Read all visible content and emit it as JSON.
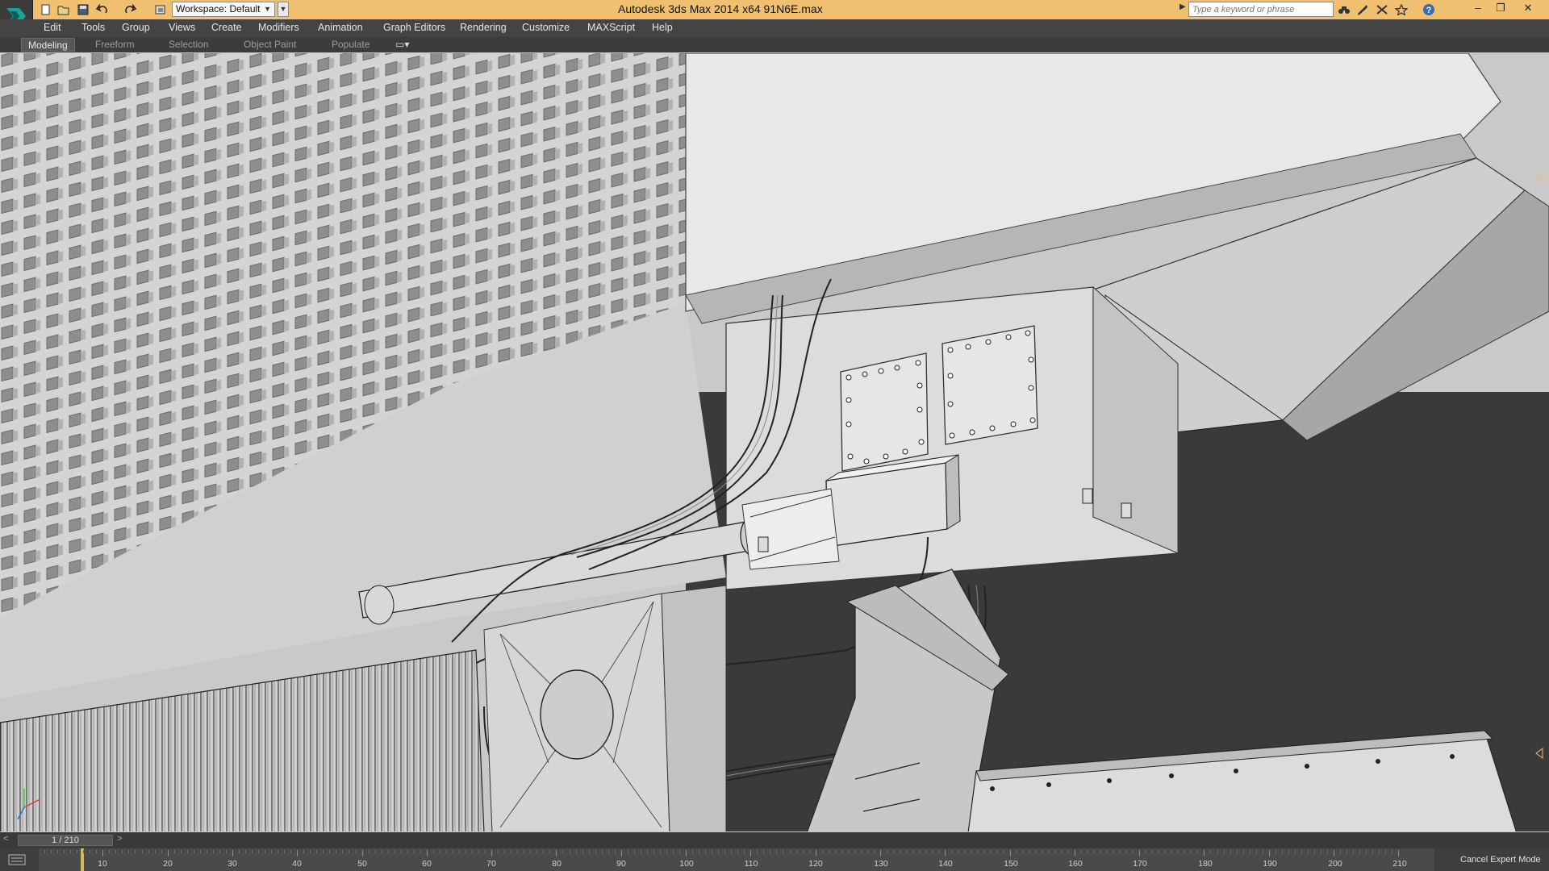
{
  "app": {
    "title": "Autodesk 3ds Max  2014 x64     91N6E.max",
    "workspace": "Workspace: Default"
  },
  "search": {
    "placeholder": "Type a keyword or phrase"
  },
  "menu": [
    "Edit",
    "Tools",
    "Group",
    "Views",
    "Create",
    "Modifiers",
    "Animation",
    "Graph Editors",
    "Rendering",
    "Customize",
    "MAXScript",
    "Help"
  ],
  "ribbon": {
    "tabs": [
      "Modeling",
      "Freeform",
      "Selection",
      "Object Paint",
      "Populate"
    ],
    "active": "Modeling"
  },
  "timeline": {
    "frame": "1 / 210",
    "prev": "<",
    "next": ">",
    "ticks": [
      "10",
      "20",
      "30",
      "40",
      "50",
      "60",
      "70",
      "80",
      "90",
      "100",
      "110",
      "120",
      "130",
      "140",
      "150",
      "160",
      "170",
      "180",
      "190",
      "200",
      "210"
    ]
  },
  "status": {
    "cancel_expert": "Cancel Expert Mode"
  },
  "icons": {
    "logo": "3dsmax-logo-icon",
    "new": "new-file-icon",
    "open": "open-file-icon",
    "save": "save-icon",
    "undo": "undo-icon",
    "redo": "redo-icon",
    "project": "project-folder-icon",
    "binoculars": "binoculars-icon",
    "tools": "tools-icon",
    "exchange": "exchange-icon",
    "favorites": "star-icon",
    "help": "help-icon",
    "minimize": "minimize-icon",
    "restore": "restore-icon",
    "close": "close-icon"
  },
  "colors": {
    "titlebar": "#f0c070",
    "menubar": "#444444",
    "viewport_bg": "#c9c9c9",
    "dark_bg": "#3a3a3a",
    "time_handle": "#d6b85a"
  }
}
